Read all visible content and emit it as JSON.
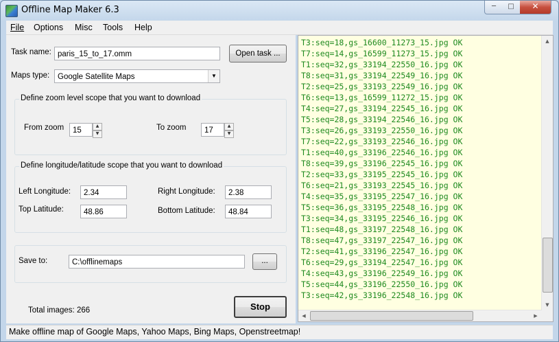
{
  "window": {
    "title": "Offline Map Maker 6.3"
  },
  "menu": [
    "File",
    "Options",
    "Misc",
    "Tools",
    "Help"
  ],
  "task": {
    "label": "Task name:",
    "value": "paris_15_to_17.omm",
    "open_button": "Open task ..."
  },
  "maps": {
    "label": "Maps type:",
    "value": "Google Satellite Maps"
  },
  "zoom": {
    "legend": "Define zoom level scope that you want to download",
    "from_label": "From zoom",
    "from_value": "15",
    "to_label": "To zoom",
    "to_value": "17"
  },
  "coords": {
    "legend": "Define longitude/latitude scope that you want to download",
    "left_lon_label": "Left Longitude:",
    "left_lon_value": "2.34",
    "right_lon_label": "Right Longitude:",
    "right_lon_value": "2.38",
    "top_lat_label": "Top Latitude:",
    "top_lat_value": "48.86",
    "bottom_lat_label": "Bottom Latitude:",
    "bottom_lat_value": "48.84"
  },
  "save": {
    "label": "Save to:",
    "value": "C:\\offlinemaps",
    "browse_button": "..."
  },
  "total": {
    "label": "Total images: 266"
  },
  "stop_button": "Stop",
  "log": [
    "T3:seq=18,gs_16600_11273_15.jpg OK",
    "T7:seq=14,gs_16599_11273_15.jpg OK",
    "T1:seq=32,gs_33194_22550_16.jpg OK",
    "T8:seq=31,gs_33194_22549_16.jpg OK",
    "T2:seq=25,gs_33193_22549_16.jpg OK",
    "T6:seq=13,gs_16599_11272_15.jpg OK",
    "T4:seq=27,gs_33194_22545_16.jpg OK",
    "T5:seq=28,gs_33194_22546_16.jpg OK",
    "T3:seq=26,gs_33193_22550_16.jpg OK",
    "T7:seq=22,gs_33193_22546_16.jpg OK",
    "T1:seq=40,gs_33196_22546_16.jpg OK",
    "T8:seq=39,gs_33196_22545_16.jpg OK",
    "T2:seq=33,gs_33195_22545_16.jpg OK",
    "T6:seq=21,gs_33193_22545_16.jpg OK",
    "T4:seq=35,gs_33195_22547_16.jpg OK",
    "T5:seq=36,gs_33195_22548_16.jpg OK",
    "T3:seq=34,gs_33195_22546_16.jpg OK",
    "T1:seq=48,gs_33197_22548_16.jpg OK",
    "T8:seq=47,gs_33197_22547_16.jpg OK",
    "T2:seq=41,gs_33196_22547_16.jpg OK",
    "T6:seq=29,gs_33194_22547_16.jpg OK",
    "T4:seq=43,gs_33196_22549_16.jpg OK",
    "T5:seq=44,gs_33196_22550_16.jpg OK",
    "T3:seq=42,gs_33196_22548_16.jpg OK"
  ],
  "status": "Make offline map of Google Maps, Yahoo Maps, Bing Maps, Openstreetmap!",
  "colors": {
    "log_text": "#1f8a1f",
    "log_bg": "#ffffe1",
    "close_button": "#c7503f"
  }
}
